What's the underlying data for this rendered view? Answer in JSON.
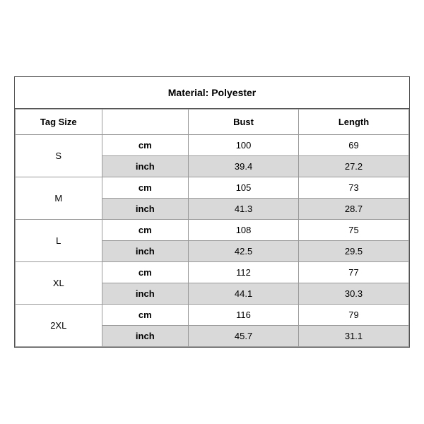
{
  "title": "Material: Polyester",
  "headers": {
    "tag_size": "Tag Size",
    "bust": "Bust",
    "length": "Length"
  },
  "sizes": [
    {
      "tag": "S",
      "cm": {
        "bust": "100",
        "length": "69"
      },
      "inch": {
        "bust": "39.4",
        "length": "27.2"
      }
    },
    {
      "tag": "M",
      "cm": {
        "bust": "105",
        "length": "73"
      },
      "inch": {
        "bust": "41.3",
        "length": "28.7"
      }
    },
    {
      "tag": "L",
      "cm": {
        "bust": "108",
        "length": "75"
      },
      "inch": {
        "bust": "42.5",
        "length": "29.5"
      }
    },
    {
      "tag": "XL",
      "cm": {
        "bust": "112",
        "length": "77"
      },
      "inch": {
        "bust": "44.1",
        "length": "30.3"
      }
    },
    {
      "tag": "2XL",
      "cm": {
        "bust": "116",
        "length": "79"
      },
      "inch": {
        "bust": "45.7",
        "length": "31.1"
      }
    }
  ],
  "unit_labels": {
    "cm": "cm",
    "inch": "inch"
  }
}
